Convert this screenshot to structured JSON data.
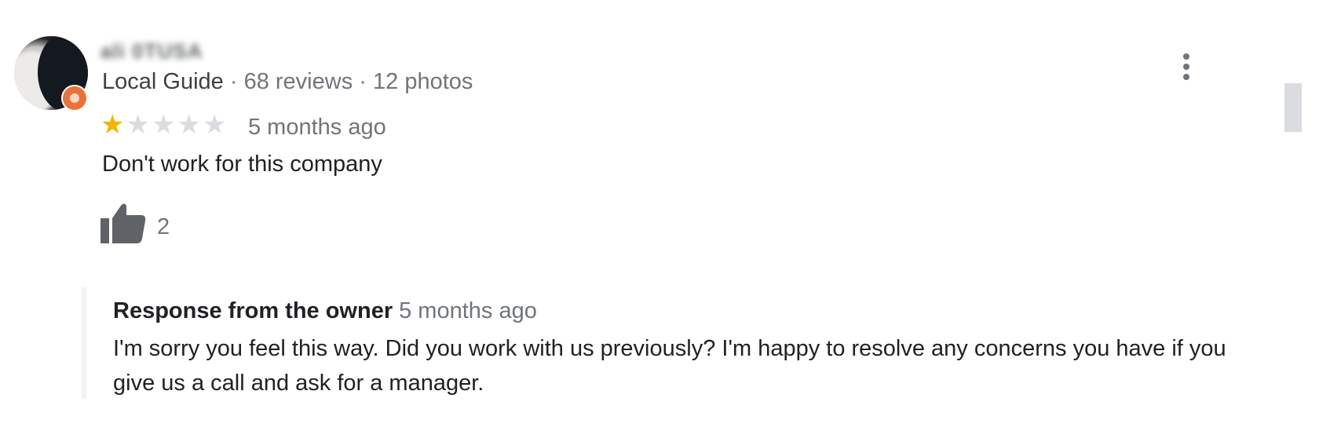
{
  "review": {
    "author_name": "ali 0TUSA",
    "local_guide_label": "Local Guide",
    "reviews_count": "68 reviews",
    "photos_count": "12 photos",
    "separator": "·",
    "rating": 1,
    "rating_max": 5,
    "time": "5 months ago",
    "text": "Don't work for this company",
    "likes": "2",
    "star_color": "#f4b400",
    "icons": {
      "like": "thumb-up-icon",
      "more": "more-vert-icon"
    }
  },
  "owner_response": {
    "label": "Response from the owner",
    "time": "5 months ago",
    "text": "I'm sorry you feel this way. Did you work with us previously? I'm happy to resolve any concerns you have if you give us a call and ask for a manager."
  }
}
